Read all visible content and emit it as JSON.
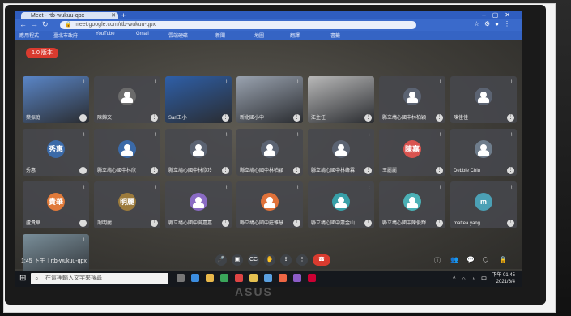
{
  "browser": {
    "tab_title": "Meet - rtb-wukuu-qpx",
    "url": "meet.google.com/rtb-wukuu-qpx",
    "bookmarks": [
      "應用程式",
      "臺北市政府",
      "YouTube",
      "Gmail",
      "雲端硬碟",
      "新聞",
      "地圖",
      "翻譯",
      "書籤"
    ]
  },
  "meet": {
    "people_button": "1.0 版本",
    "tiles": [
      {
        "name": "葉振庭",
        "kind": "image",
        "color": "#5a86c8"
      },
      {
        "name": "陳錦文",
        "kind": "avatar",
        "color": "#6b6b6b"
      },
      {
        "name": "Sari王小",
        "kind": "video",
        "color": "#2e5fa8"
      },
      {
        "name": "新北國小中",
        "kind": "video",
        "color": "#9aa3b0"
      },
      {
        "name": "江主任",
        "kind": "video",
        "color": "#b9b9b9"
      },
      {
        "name": "縣立鳩心國中林柏穎",
        "kind": "avatar",
        "color": "#5b6372"
      },
      {
        "name": "陳佳佳",
        "kind": "avatar",
        "color": "#5b6372"
      },
      {
        "name": "秀惠",
        "kind": "letter",
        "color": "#3b6aa8",
        "letter": "秀惠"
      },
      {
        "name": "縣立鳩心國中林欣",
        "kind": "avatar",
        "color": "#3b6aa8"
      },
      {
        "name": "縣立鳩心國中林欣玲",
        "kind": "avatar",
        "color": "#5b6372"
      },
      {
        "name": "縣立鳩心國中林柏穎",
        "kind": "avatar",
        "color": "#5b6372"
      },
      {
        "name": "縣立鳩心國中林峰霖",
        "kind": "avatar",
        "color": "#5b6372"
      },
      {
        "name": "王麗麗",
        "kind": "letter",
        "color": "#d9534f",
        "letter": "陳嘉"
      },
      {
        "name": "Debbie Chiu",
        "kind": "avatar",
        "color": "#6f7d8c"
      },
      {
        "name": "盧貴華",
        "kind": "letter",
        "color": "#e07a3a",
        "letter": "貴華"
      },
      {
        "name": "謝明麗",
        "kind": "letter",
        "color": "#9c7b3c",
        "letter": "明麗"
      },
      {
        "name": "縣立鳩心國中吳嘉嘉",
        "kind": "avatar",
        "color": "#8a6bc4"
      },
      {
        "name": "縣立鳩心國中莊雅慧",
        "kind": "avatar",
        "color": "#e0723a"
      },
      {
        "name": "縣立鳩心國中蕭金山",
        "kind": "avatar",
        "color": "#38a0a8"
      },
      {
        "name": "縣立鳩心國中陳俊輝",
        "kind": "avatar",
        "color": "#4bb0b5"
      },
      {
        "name": "mattea yang",
        "kind": "letter",
        "color": "#4ba0b5",
        "letter": "m"
      },
      {
        "name": "",
        "kind": "video",
        "color": "#7a8f9a"
      }
    ],
    "meeting_time": "1:45 下午｜rtb-wukuu-qpx"
  },
  "taskbar": {
    "search_placeholder": "在這裡輸入文字來搜尋",
    "clock_time": "下午 01:45",
    "clock_date": "2021/6/4"
  },
  "bezel_logo": "ASUS"
}
